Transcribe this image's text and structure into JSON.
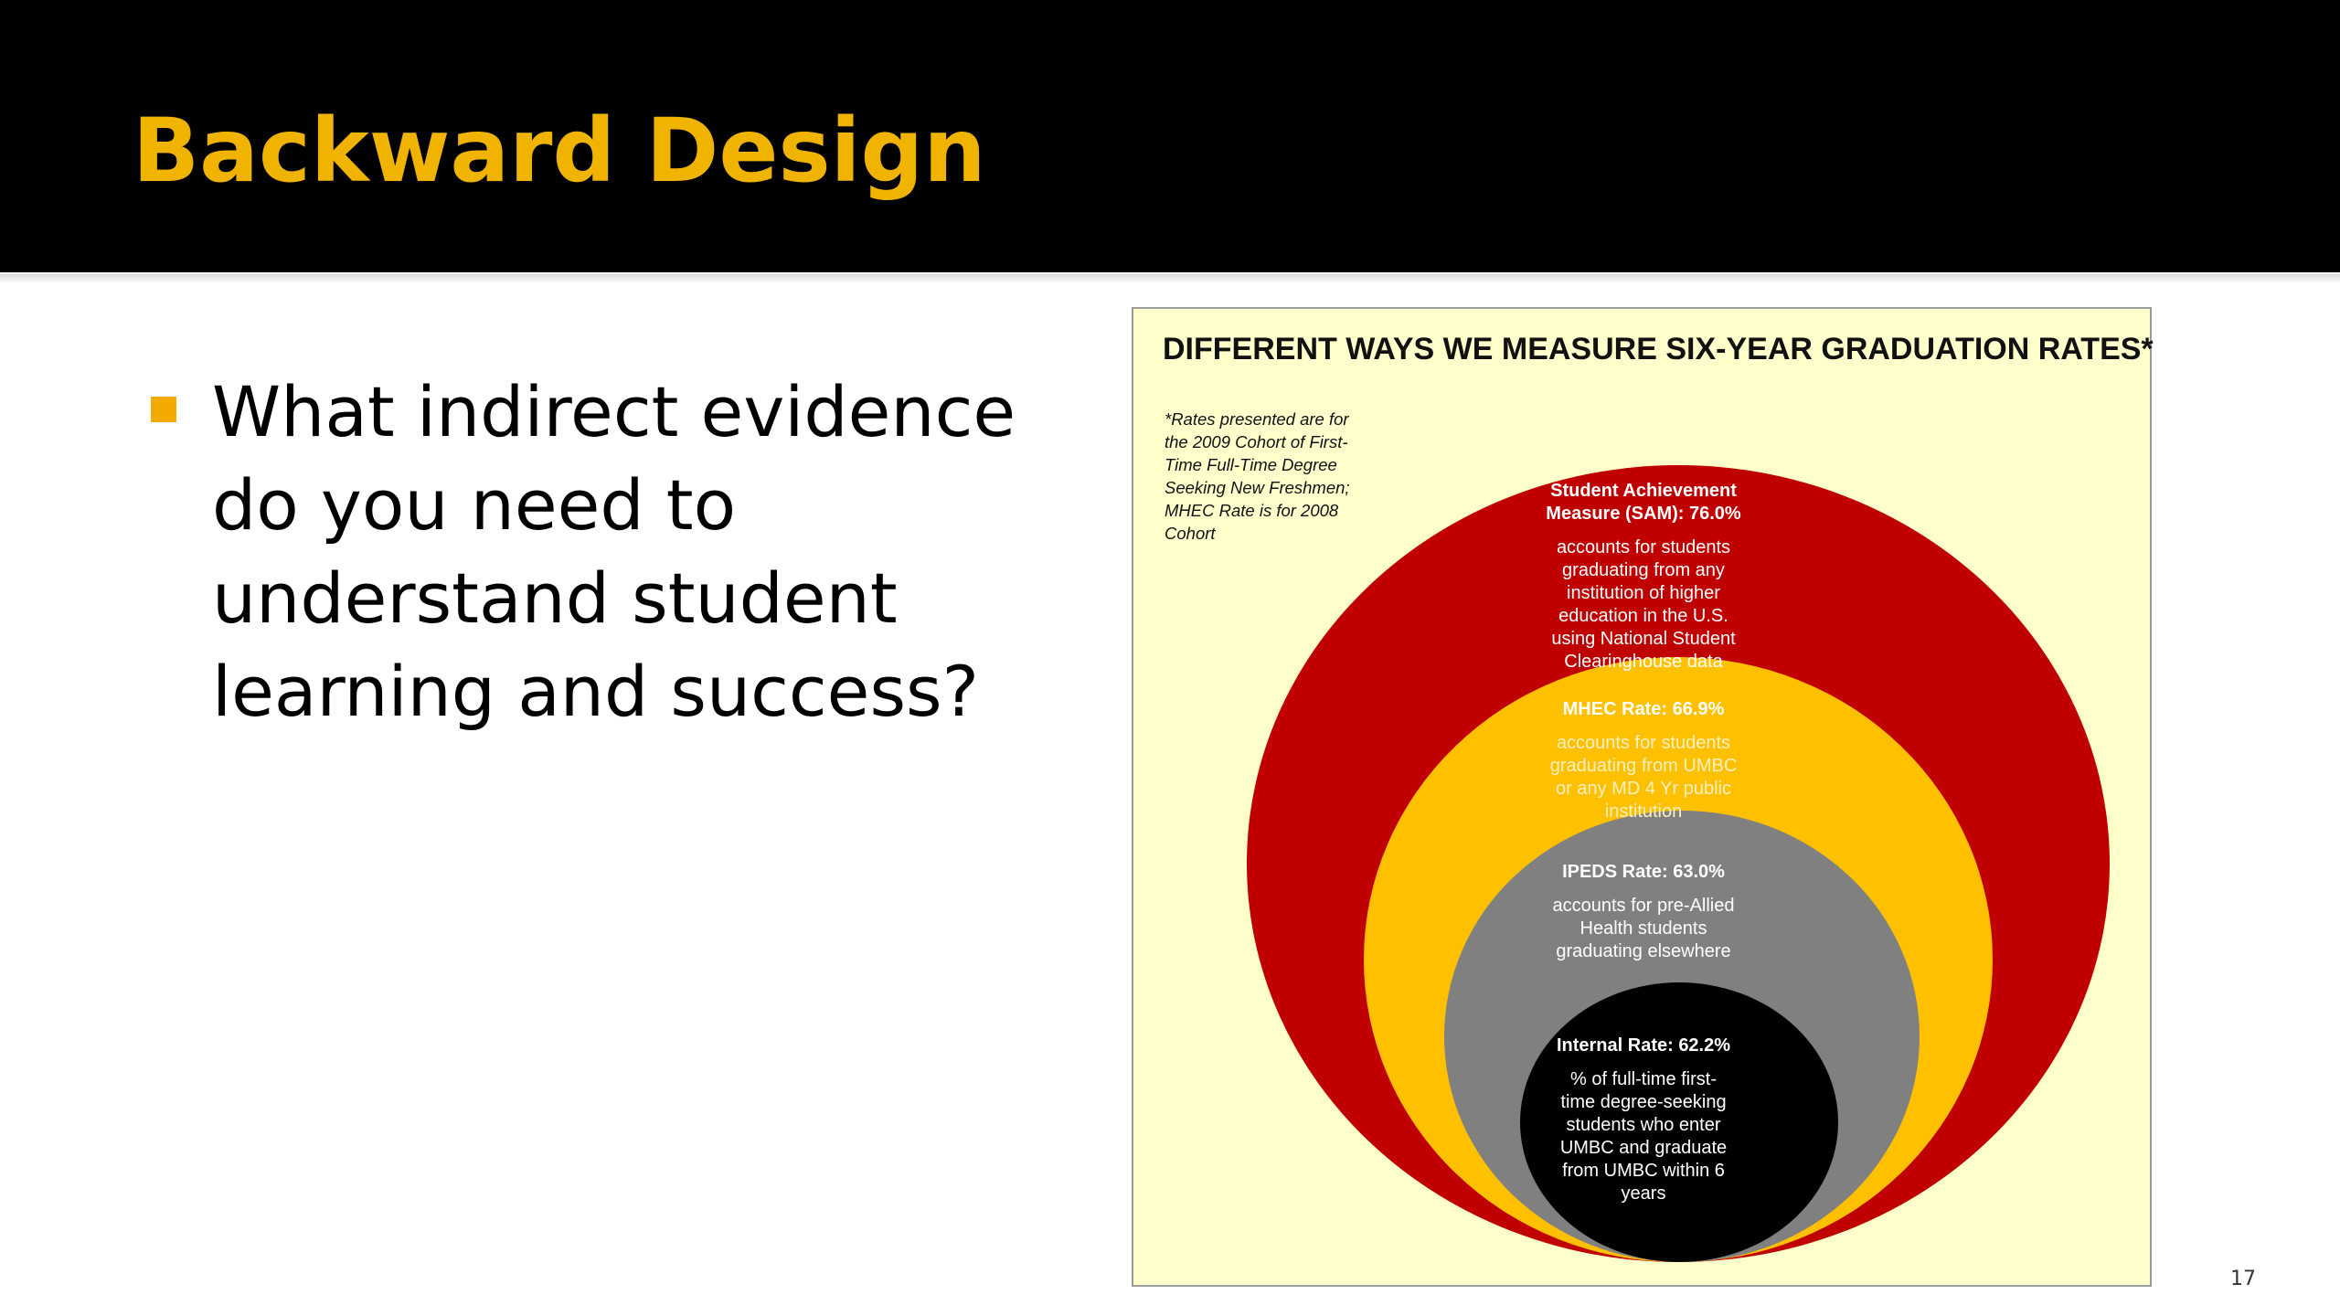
{
  "slide": {
    "title": "Backward Design",
    "bullet": "What indirect evidence do you need to understand student learning and success?",
    "slide_number": "17"
  },
  "diagram": {
    "heading": "DIFFERENT WAYS WE MEASURE SIX-YEAR GRADUATION RATES*",
    "footnote": "*Rates presented are for the 2009 Cohort of First-Time Full-Time Degree Seeking New Freshmen; MHEC Rate is for 2008 Cohort",
    "colors": {
      "background": "#ffffcc",
      "sam": "#c00000",
      "mhec": "#ffc000",
      "ipeds": "#808080",
      "internal": "#000000"
    },
    "rings": [
      {
        "title": "Student Achievement Measure (SAM):  76.0%",
        "description": "accounts for students graduating from any institution of higher education in the U.S. using National Student Clearinghouse data"
      },
      {
        "title": "MHEC Rate: 66.9%",
        "description": "accounts for students graduating from UMBC or any MD 4 Yr public institution"
      },
      {
        "title": "IPEDS Rate: 63.0%",
        "description": "accounts for pre-Allied Health students graduating elsewhere"
      },
      {
        "title": "Internal Rate: 62.2%",
        "description": "% of full-time first-time degree-seeking students  who enter UMBC and graduate from UMBC within 6 years"
      }
    ]
  }
}
